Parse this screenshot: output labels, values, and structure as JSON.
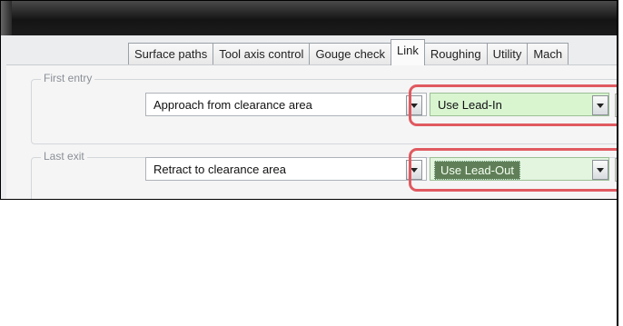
{
  "tabs": [
    {
      "label": "Surface paths"
    },
    {
      "label": "Tool axis control"
    },
    {
      "label": "Gouge check"
    },
    {
      "label": "Link",
      "active": true
    },
    {
      "label": "Roughing"
    },
    {
      "label": "Utility"
    },
    {
      "label": "Mach"
    }
  ],
  "first_entry": {
    "group_label": "First entry",
    "approach_value": "Approach from clearance area",
    "lead_value": "Use Lead-In"
  },
  "last_exit": {
    "group_label": "Last exit",
    "retract_value": "Retract to clearance area",
    "lead_value": "Use Lead-Out"
  },
  "colors": {
    "highlight": "#e05a60",
    "lead_field": "#d8f5d0",
    "selected_text_bg": "#607f58"
  }
}
